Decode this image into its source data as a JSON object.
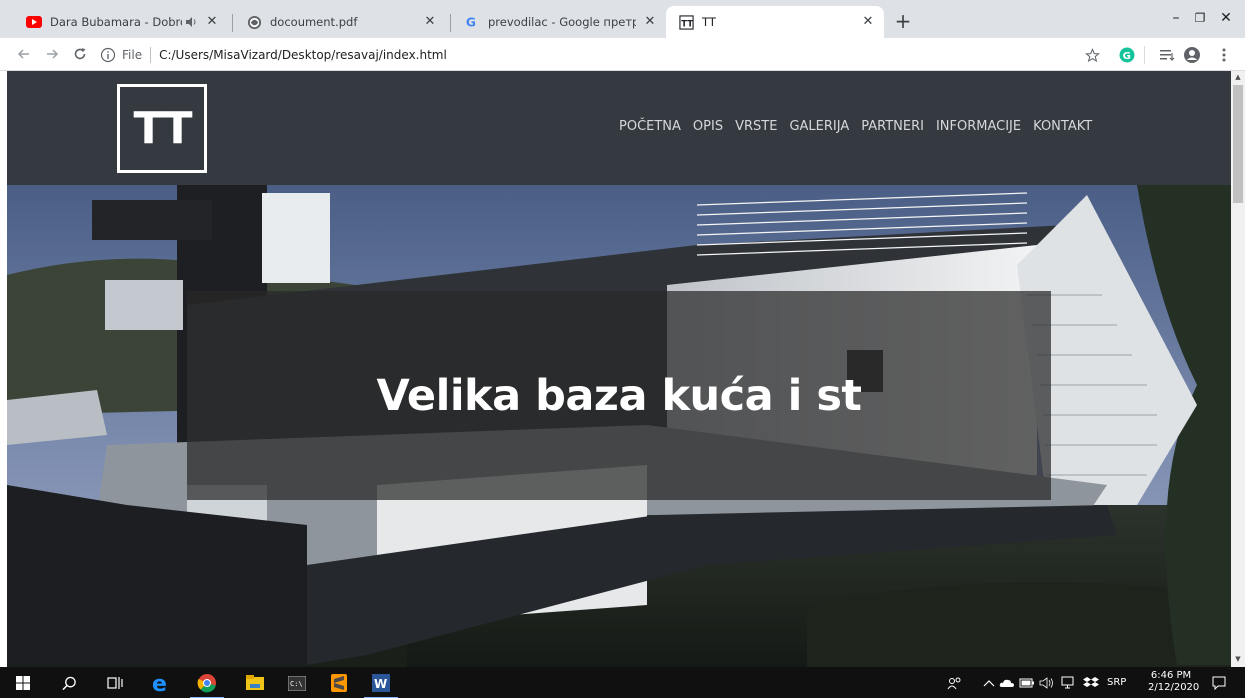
{
  "browser": {
    "tabs": [
      {
        "title": "Dara Bubamara - Dobro jutro",
        "favicon": "youtube-icon",
        "audio": true,
        "active": false
      },
      {
        "title": "docoument.pdf",
        "favicon": "globe-icon",
        "active": false
      },
      {
        "title": "prevodilac - Google претрага",
        "favicon": "google-icon",
        "active": false
      },
      {
        "title": "TT",
        "favicon": "tt-icon",
        "active": true
      }
    ],
    "new_tab_label": "+",
    "window_controls": {
      "minimize": "–",
      "restore": "❐",
      "close": "✕"
    },
    "address": {
      "scheme_label": "File",
      "url": "C:/Users/MisaVizard/Desktop/resavaj/index.html"
    }
  },
  "site": {
    "logo_text": "TT",
    "nav": [
      "POČETNA",
      "OPIS",
      "VRSTE",
      "GALERIJA",
      "PARTNERI",
      "INFORMACIJE",
      "KONTAKT"
    ],
    "hero_heading": "Velika baza kuća i st"
  },
  "taskbar": {
    "language": "SRP",
    "time": "6:46 PM",
    "date": "2/12/2020"
  },
  "colors": {
    "header_bg": "#343a40",
    "taskbar_bg": "#101010",
    "tabstrip_bg": "#dee1e6"
  }
}
